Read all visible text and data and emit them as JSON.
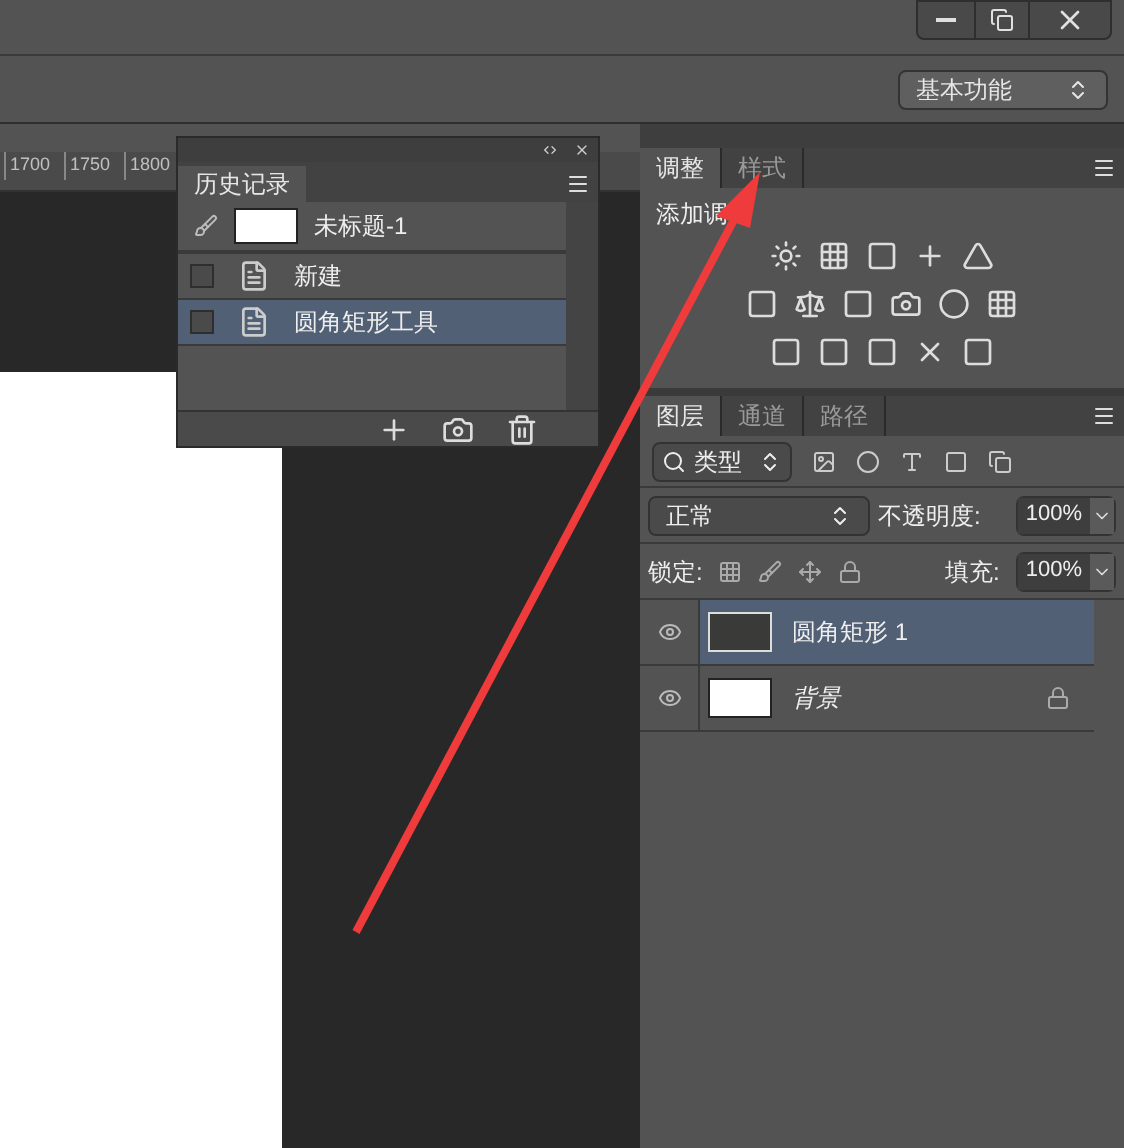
{
  "workspace": {
    "label": "基本功能"
  },
  "ruler": {
    "ticks": [
      "1700",
      "1750",
      "1800"
    ]
  },
  "history": {
    "title": "历史记录",
    "snapshot": "未标题-1",
    "items": [
      {
        "label": "新建",
        "selected": false
      },
      {
        "label": "圆角矩形工具",
        "selected": true
      }
    ]
  },
  "adjustments": {
    "tabs": [
      {
        "label": "调整",
        "selected": true
      },
      {
        "label": "样式",
        "selected": false
      }
    ],
    "heading": "添加调"
  },
  "layers": {
    "tabs": [
      {
        "label": "图层",
        "selected": true
      },
      {
        "label": "通道",
        "selected": false
      },
      {
        "label": "路径",
        "selected": false
      }
    ],
    "filter": "类型",
    "blend": "正常",
    "opacity_label": "不透明度:",
    "opacity": "100%",
    "lock_label": "锁定:",
    "fill_label": "填充:",
    "fill": "100%",
    "items": [
      {
        "name": "圆角矩形 1",
        "kind": "shape",
        "selected": true,
        "italic": false,
        "locked": false
      },
      {
        "name": "背景",
        "kind": "background",
        "selected": false,
        "italic": true,
        "locked": true
      }
    ]
  },
  "annotation": {
    "kind": "arrow"
  }
}
